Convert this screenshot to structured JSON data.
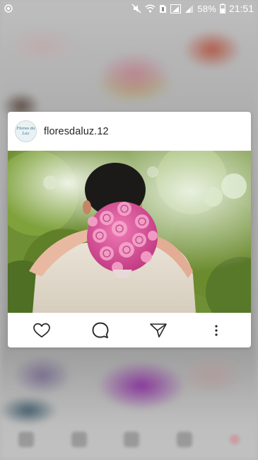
{
  "status_bar": {
    "icons": [
      "mute-icon",
      "wifi-icon",
      "notification-icon",
      "sim-signal-icon",
      "signal-icon",
      "battery-icon"
    ],
    "battery_percent": "58%",
    "time": "21:51"
  },
  "post_preview": {
    "username": "floresdaluz.12",
    "avatar_text": "Flores da Luz",
    "image_subject": "bride hugging groom from behind holding a pink rose bouquet",
    "actions": [
      "like-icon",
      "comment-icon",
      "share-icon",
      "more-options-icon"
    ]
  },
  "colors": {
    "card_background": "#ffffff",
    "icon_color": "#262626",
    "bouquet_pink": "#e0509a"
  }
}
